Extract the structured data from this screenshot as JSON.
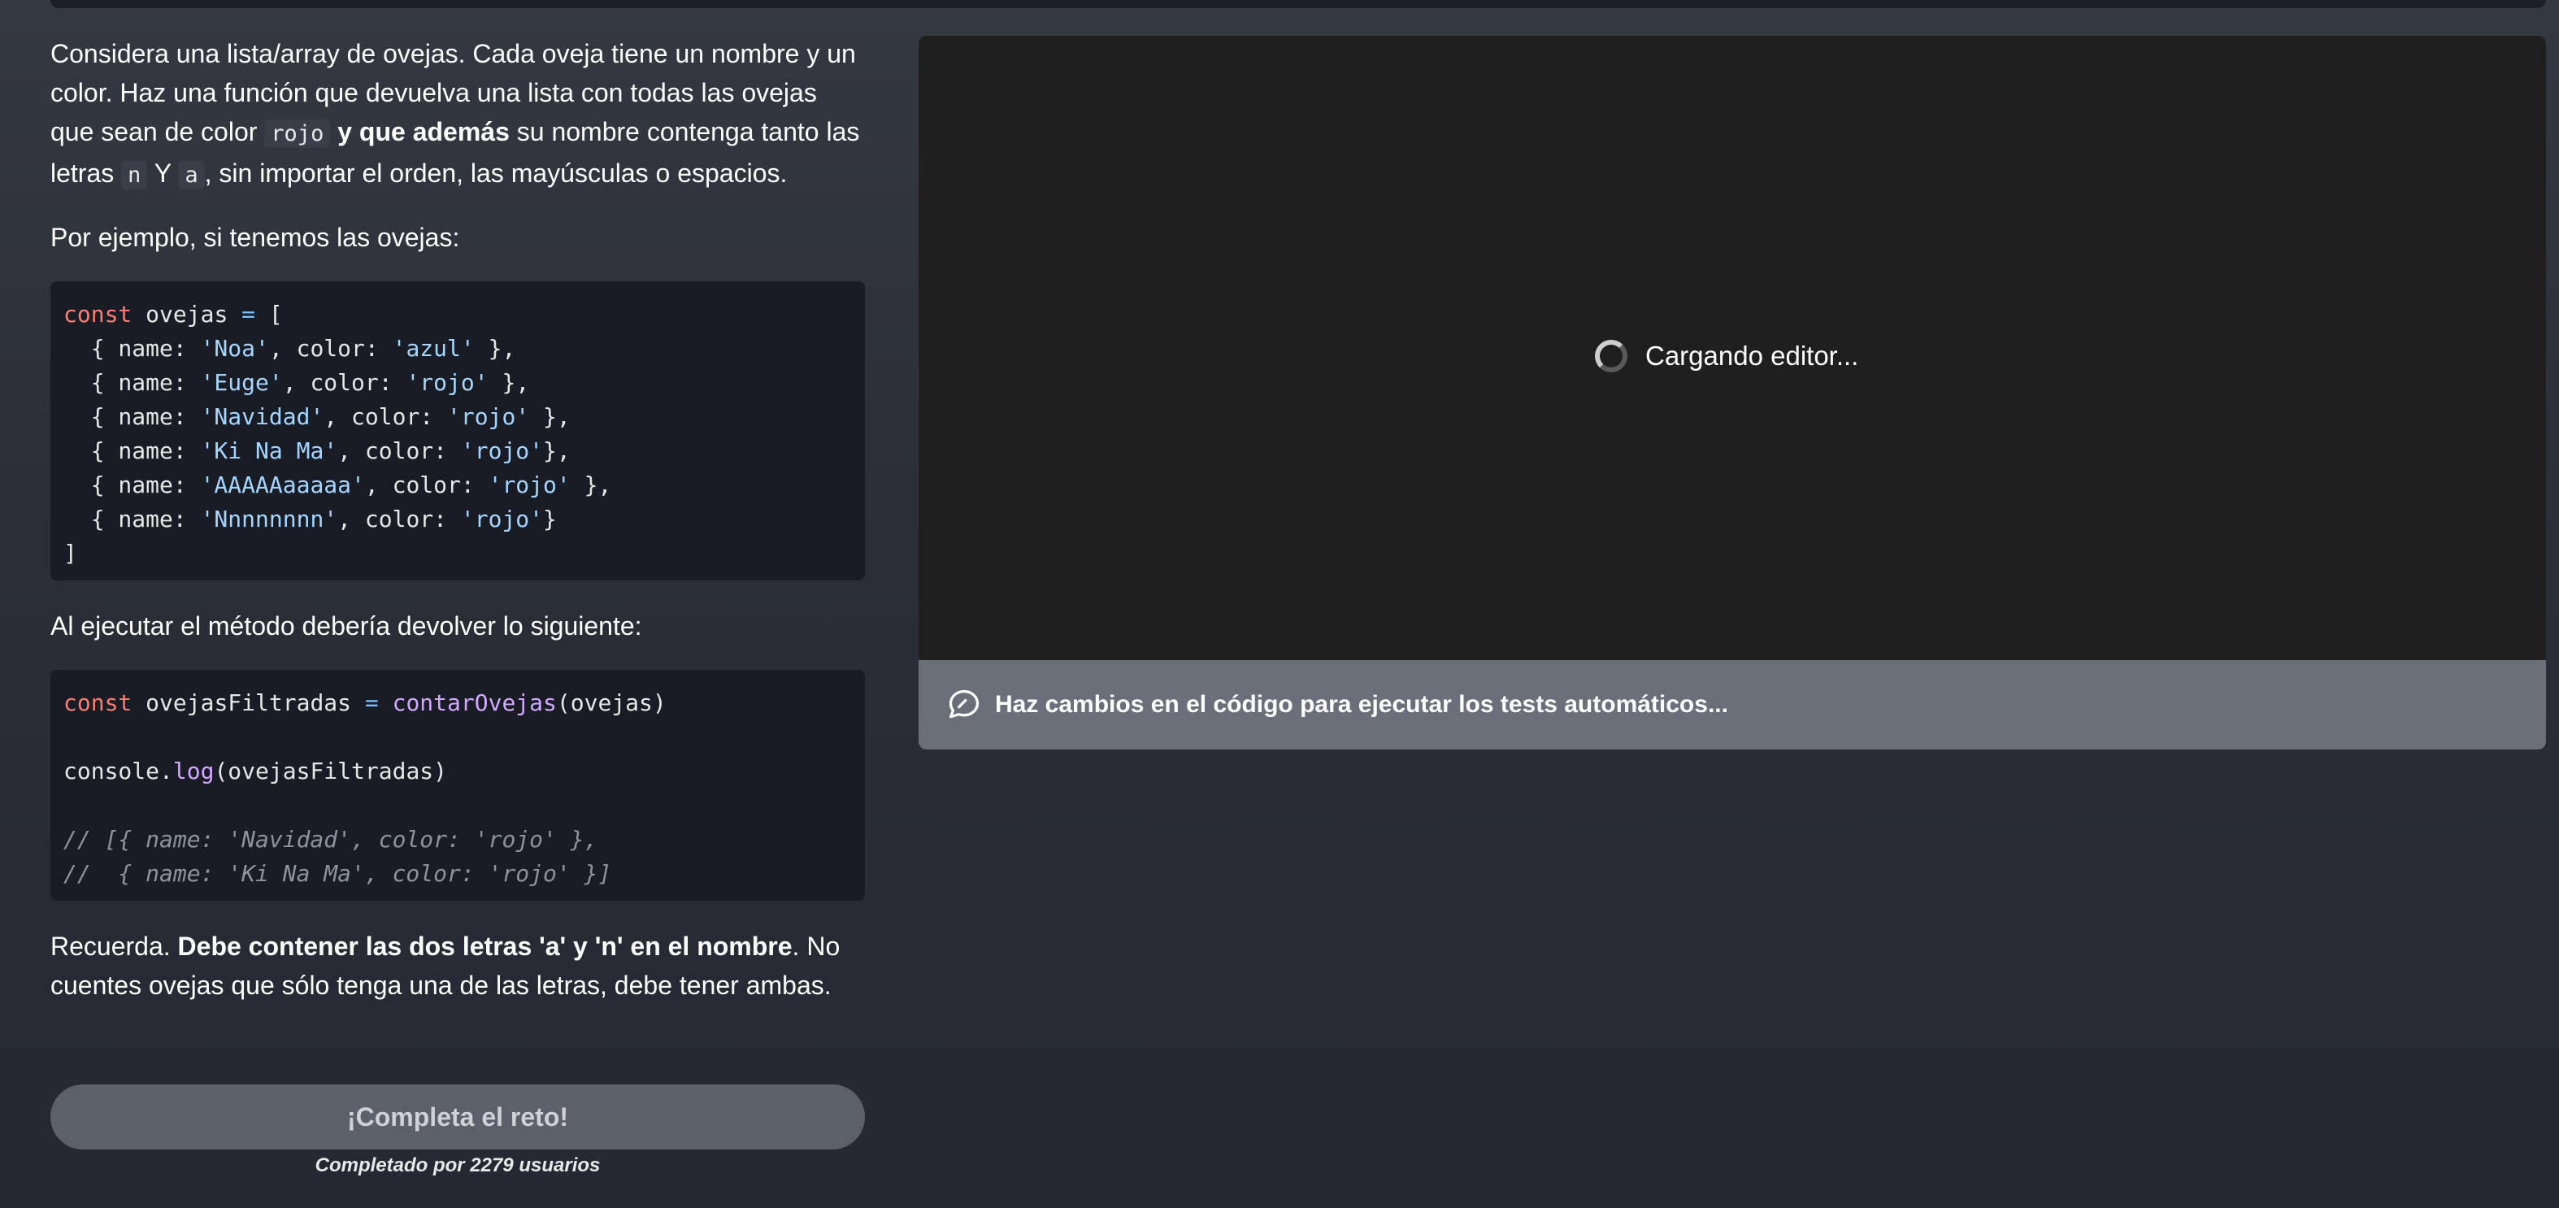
{
  "description": {
    "p1_a": "Considera una lista/array de ovejas. Cada oveja tiene un nombre y un color. Haz una función que devuelva una lista con todas las ovejas que sean de color ",
    "p1_code_rojo": "rojo",
    "p1_bold": " y que además",
    "p1_b": " su nombre contenga tanto las letras ",
    "p1_code_n": "n",
    "p1_c": " Y ",
    "p1_code_a": "a",
    "p1_d": ", sin importar el orden, las mayúsculas o espacios.",
    "p2": "Por ejemplo, si tenemos las ovejas:",
    "p3": "Al ejecutar el método debería devolver lo siguiente:",
    "p4_a": "Recuerda. ",
    "p4_bold": "Debe contener las dos letras 'a' y 'n' en el nombre",
    "p4_b": ". No cuentes ovejas que sólo tenga una de las letras, debe tener ambas."
  },
  "code_example_1": {
    "l1_kw": "const",
    "l1_name": " ovejas ",
    "l1_op": "=",
    "l1_rest": " [",
    "l2_a": "  { name: ",
    "l2_s1": "'Noa'",
    "l2_b": ", color: ",
    "l2_s2": "'azul'",
    "l2_c": " },",
    "l3_a": "  { name: ",
    "l3_s1": "'Euge'",
    "l3_b": ", color: ",
    "l3_s2": "'rojo'",
    "l3_c": " },",
    "l4_a": "  { name: ",
    "l4_s1": "'Navidad'",
    "l4_b": ", color: ",
    "l4_s2": "'rojo'",
    "l4_c": " },",
    "l5_a": "  { name: ",
    "l5_s1": "'Ki Na Ma'",
    "l5_b": ", color: ",
    "l5_s2": "'rojo'",
    "l5_c": "},",
    "l6_a": "  { name: ",
    "l6_s1": "'AAAAAaaaaa'",
    "l6_b": ", color: ",
    "l6_s2": "'rojo'",
    "l6_c": " },",
    "l7_a": "  { name: ",
    "l7_s1": "'Nnnnnnnn'",
    "l7_b": ", color: ",
    "l7_s2": "'rojo'",
    "l7_c": "}",
    "l8": "]"
  },
  "code_example_2": {
    "l1_kw": "const",
    "l1_name": " ovejasFiltradas ",
    "l1_op": "=",
    "l1_sp": " ",
    "l1_fn": "contarOvejas",
    "l1_rest": "(ovejas)",
    "l3_a": "console.",
    "l3_fn": "log",
    "l3_b": "(ovejasFiltradas)",
    "l5": "// [{ name: 'Navidad', color: 'rojo' },",
    "l6": "//  { name: 'Ki Na Ma', color: 'rojo' }]"
  },
  "actions": {
    "complete_button": "¡Completa el reto!",
    "completed_by": "Completado por 2279 usuarios"
  },
  "editor": {
    "loading_text": "Cargando editor...",
    "tests_message": "Haz cambios en el código para ejecutar los tests automáticos..."
  },
  "icons": {
    "spinner": "loading-spinner-icon",
    "tests": "chat-bubble-icon"
  },
  "colors": {
    "background": "#2b2e37",
    "code_background": "#191c24",
    "editor_background": "#1f1f1f",
    "tests_bar": "#6b6f7a",
    "button": "#5c606b",
    "keyword": "#ff7b72",
    "string": "#a5d6ff",
    "function": "#d2a8ff"
  }
}
